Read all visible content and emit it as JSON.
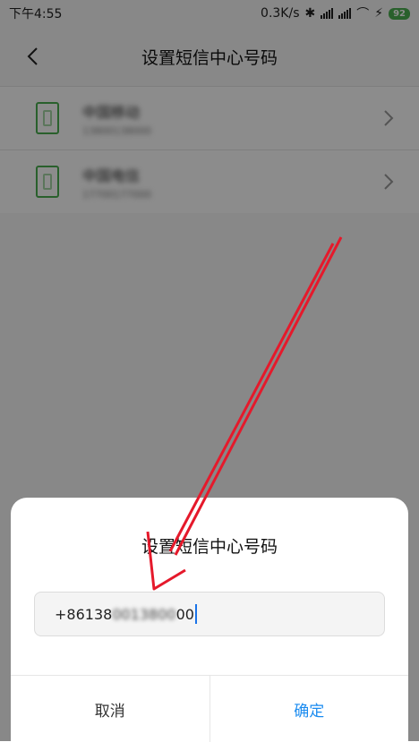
{
  "status_bar": {
    "time": "下午4:55",
    "network_speed": "0.3K/s",
    "battery": "92"
  },
  "header": {
    "title": "设置短信中心号码"
  },
  "sim_list": [
    {
      "name": "中国移动",
      "number": "13800138000"
    },
    {
      "name": "中国电信",
      "number": "17700177000"
    }
  ],
  "dialog": {
    "title": "设置短信中心号码",
    "input_prefix": "+86138",
    "input_blurred": "0013800",
    "input_suffix": "00",
    "cancel_label": "取消",
    "confirm_label": "确定"
  },
  "colors": {
    "accent": "#1a8bf0",
    "sim_green": "#4caf50",
    "annotation_red": "#e5192b"
  }
}
